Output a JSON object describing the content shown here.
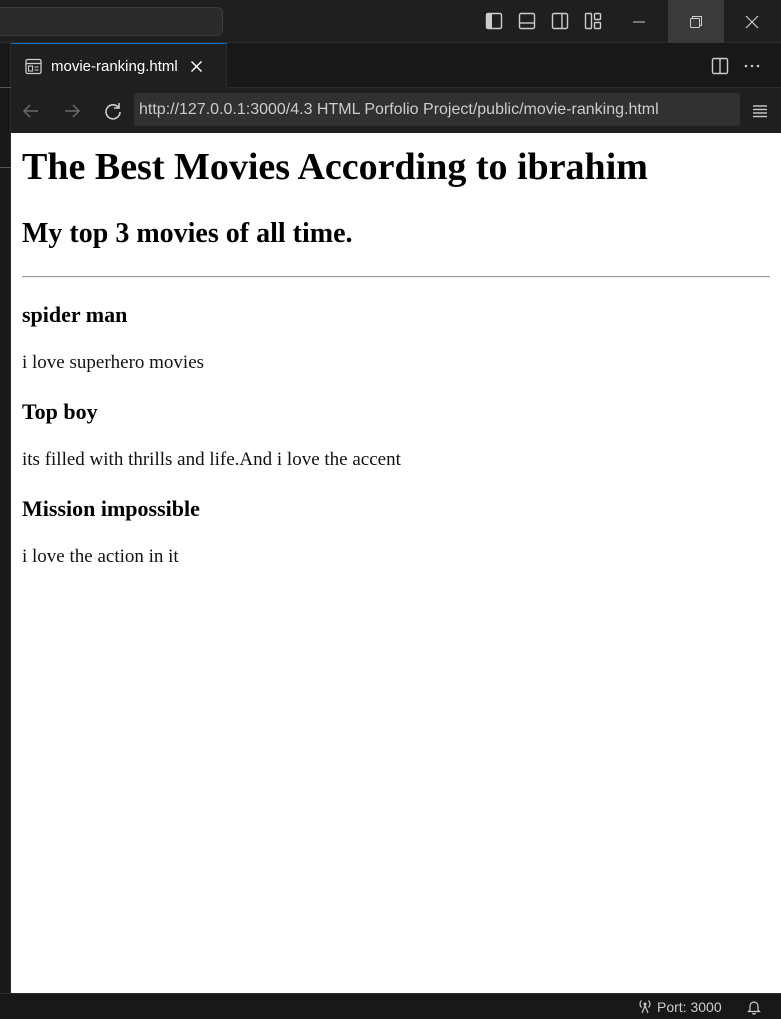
{
  "tab": {
    "label": "movie-ranking.html",
    "icon": "preview-icon"
  },
  "navbar": {
    "url": "http://127.0.0.1:3000/4.3 HTML Porfolio Project/public/movie-ranking.html"
  },
  "page": {
    "heading": "The Best Movies According to ibrahim",
    "subheading": "My top 3 movies of all time.",
    "movies": [
      {
        "title": "spider man",
        "note": "i love superhero movies"
      },
      {
        "title": "Top boy",
        "note": "its filled with thrills and life.And i love the accent"
      },
      {
        "title": "Mission impossible",
        "note": "i love the action in it"
      }
    ]
  },
  "statusbar": {
    "port": "Port: 3000"
  },
  "colors": {
    "accent": "#0078d4",
    "chrome": "#1f1f1f",
    "page_bg": "#ffffff"
  }
}
